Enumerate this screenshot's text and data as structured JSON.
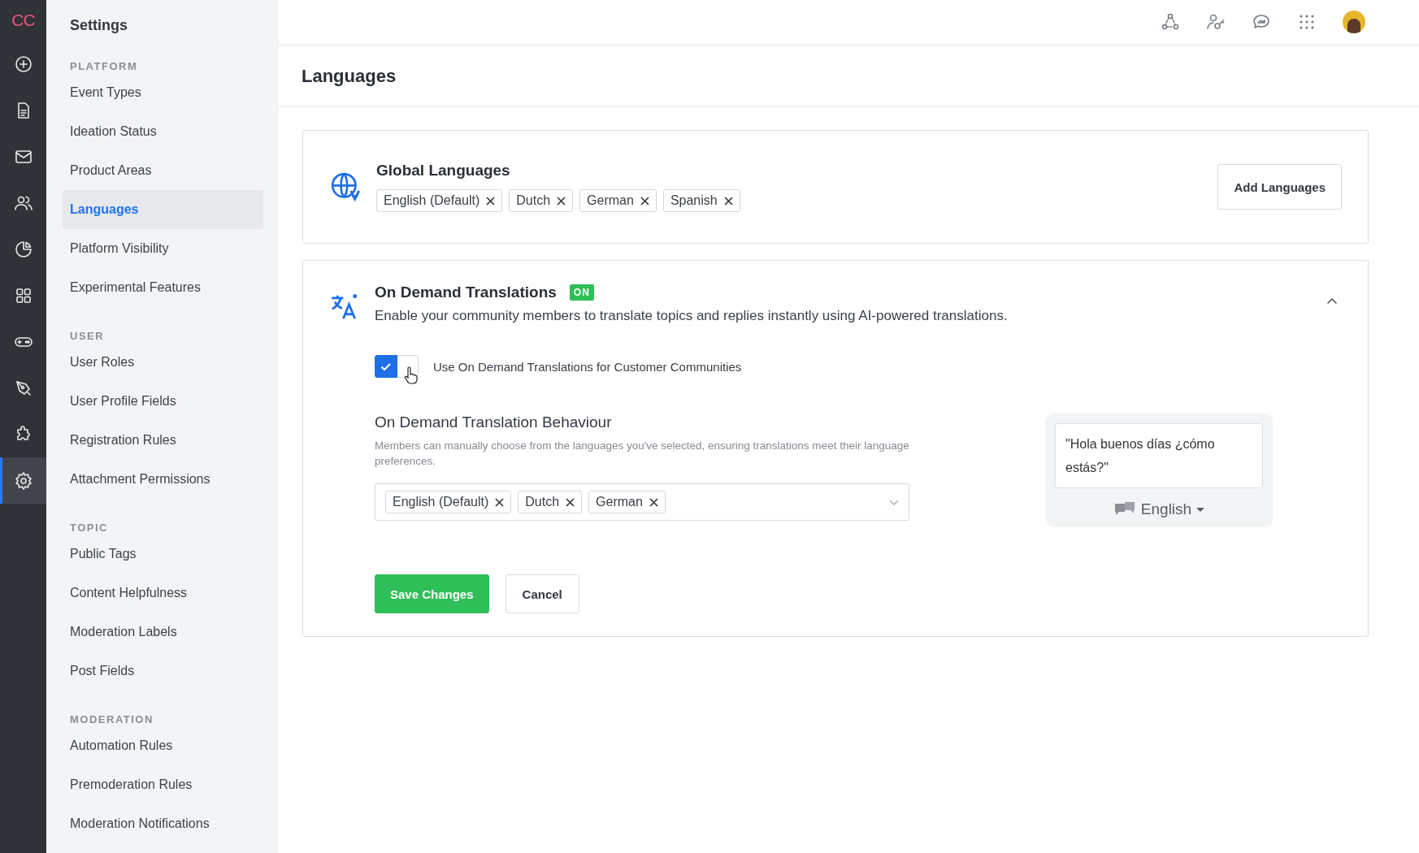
{
  "rail": {
    "logo": "CC",
    "items": [
      {
        "kind": "plus",
        "selected": false
      },
      {
        "kind": "document",
        "selected": false
      },
      {
        "kind": "mail",
        "selected": false
      },
      {
        "kind": "people",
        "selected": false
      },
      {
        "kind": "pie",
        "selected": false
      },
      {
        "kind": "grid",
        "selected": false
      },
      {
        "kind": "gamepad",
        "selected": false
      },
      {
        "kind": "pen",
        "selected": false
      },
      {
        "kind": "puzzle",
        "selected": false
      },
      {
        "kind": "gear",
        "selected": true
      }
    ]
  },
  "sidebar": {
    "title": "Settings",
    "sections": [
      {
        "heading": "PLATFORM",
        "items": [
          {
            "label": "Event Types",
            "selected": false
          },
          {
            "label": "Ideation Status",
            "selected": false
          },
          {
            "label": "Product Areas",
            "selected": false
          },
          {
            "label": "Languages",
            "selected": true
          },
          {
            "label": "Platform Visibility",
            "selected": false
          },
          {
            "label": "Experimental Features",
            "selected": false
          }
        ]
      },
      {
        "heading": "USER",
        "items": [
          {
            "label": "User Roles",
            "selected": false
          },
          {
            "label": "User Profile Fields",
            "selected": false
          },
          {
            "label": "Registration Rules",
            "selected": false
          },
          {
            "label": "Attachment Permissions",
            "selected": false
          }
        ]
      },
      {
        "heading": "TOPIC",
        "items": [
          {
            "label": "Public Tags",
            "selected": false
          },
          {
            "label": "Content Helpfulness",
            "selected": false
          },
          {
            "label": "Moderation Labels",
            "selected": false
          },
          {
            "label": "Post Fields",
            "selected": false
          }
        ]
      },
      {
        "heading": "MODERATION",
        "items": [
          {
            "label": "Automation Rules",
            "selected": false
          },
          {
            "label": "Premoderation Rules",
            "selected": false
          },
          {
            "label": "Moderation Notifications",
            "selected": false
          }
        ]
      }
    ]
  },
  "page_title": "Languages",
  "global_languages": {
    "title": "Global Languages",
    "tags": [
      "English (Default)",
      "Dutch",
      "German",
      "Spanish"
    ],
    "button": "Add Languages"
  },
  "on_demand": {
    "title": "On Demand Translations",
    "badge": "ON",
    "expanded": true,
    "description": "Enable your community members to translate topics and replies instantly using AI-powered translations.",
    "toggle": {
      "label": "Use On Demand Translations for Customer Communities",
      "checked": true
    },
    "behaviour": {
      "title": "On Demand Translation Behaviour",
      "description": "Members can manually choose from the languages you've selected, ensuring translations meet their language preferences.",
      "tags": [
        "English (Default)",
        "Dutch",
        "German"
      ]
    },
    "preview": {
      "quote": "\"Hola buenos días ¿cómo estás?\"",
      "language": "English"
    },
    "buttons": {
      "save": "Save Changes",
      "cancel": "Cancel"
    }
  }
}
